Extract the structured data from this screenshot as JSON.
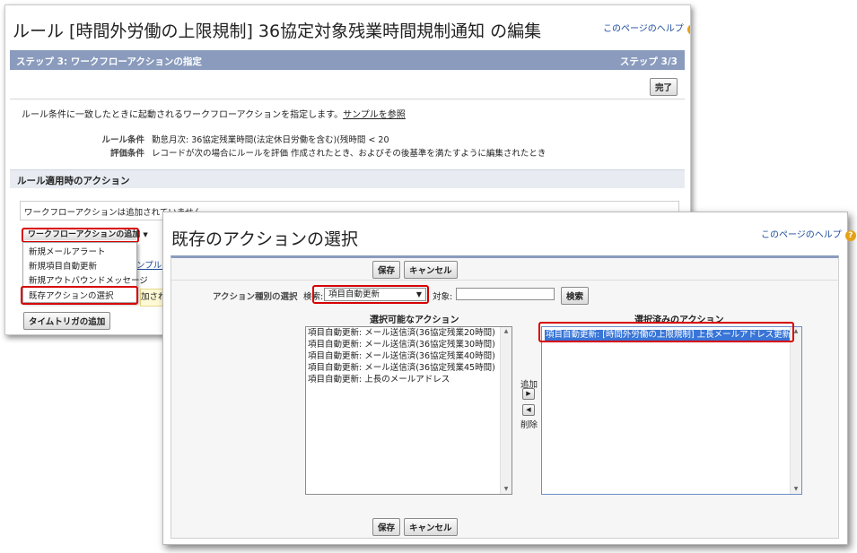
{
  "back_page": {
    "title": "ルール [時間外労働の上限規制] 36協定対象残業時間規制通知 の編集",
    "help": {
      "label": "このページのヘルプ",
      "icon": "question-icon"
    },
    "step_bar": {
      "left": "ステップ 3: ワークフローアクションの指定",
      "right": "ステップ 3/3"
    },
    "done_button": "完了",
    "description": "ルール条件に一致したときに起動されるワークフローアクションを指定します。",
    "sample_link": "サンプルを参照",
    "rule_label": "ルール条件",
    "rule_value": "勤怠月次: 36協定残業時間(法定休日労働を含む)(残時間 < 20",
    "eval_label": "評価条件",
    "eval_value": "レコードが次の場合にルールを評価 作成されたとき、およびその後基準を満たすように編集されたとき",
    "section_title": "ルール適用時のアクション",
    "no_actions_text": "ワークフローアクションは追加されていません。",
    "add_workflow_button": "ワークフローアクションの追加",
    "menu_items": [
      "新規メールアラート",
      "新規項目自動更新",
      "新規アウトバウンドメッセージ",
      "既存アクションの選択"
    ],
    "partial_sample": "ンプルを",
    "partial_text": "加されて",
    "time_trigger_button": "タイムトリガの追加"
  },
  "dialog": {
    "title": "既存のアクションの選択",
    "help": {
      "label": "このページのヘルプ",
      "icon": "question-icon"
    },
    "save_button": "保存",
    "cancel_button": "キャンセル",
    "type_label": "アクション種別の選択",
    "search_label": "検索:",
    "type_selected": "項目自動更新",
    "target_label": "対象:",
    "target_value": "",
    "search_button": "検索",
    "available_heading": "選択可能なアクション",
    "available_items": [
      "項目自動更新: メール送信済(36協定残業20時間)",
      "項目自動更新: メール送信済(36協定残業30時間)",
      "項目自動更新: メール送信済(36協定残業40時間)",
      "項目自動更新: メール送信済(36協定残業45時間)",
      "項目自動更新: 上長のメールアドレス"
    ],
    "add_label": "追加",
    "remove_label": "削除",
    "selected_heading": "選択済みのアクション",
    "selected_items": [
      "項目自動更新: [時間外労働の上限規制] 上長メールアドレス更新"
    ]
  },
  "colors": {
    "highlight_red": "#d70000",
    "step_bar": "#8a9bbd",
    "selection_blue": "#3875d7",
    "link_blue": "#1a4a9c"
  }
}
